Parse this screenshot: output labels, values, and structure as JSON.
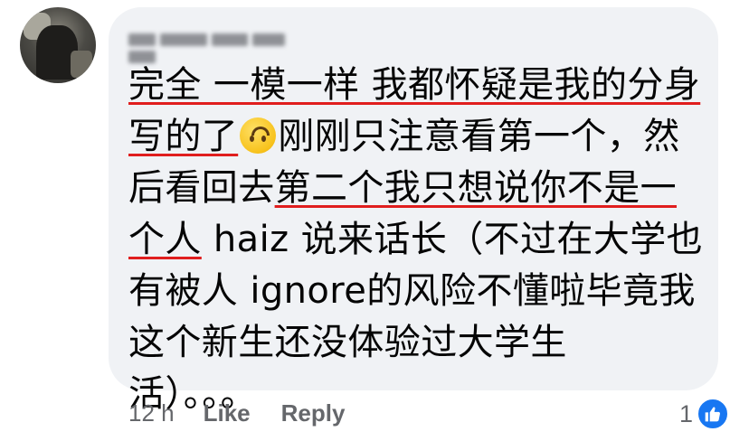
{
  "comment": {
    "author": "",
    "lines": [
      [
        {
          "t": "完全 一模一样 我都怀疑是我的分身",
          "u": true
        }
      ],
      [
        {
          "t": "写的了",
          "u": true
        },
        {
          "t": "EMOJI",
          "u": false
        },
        {
          "t": "刚刚只注意看第一个，然",
          "u": false
        }
      ],
      [
        {
          "t": "后看回去",
          "u": false
        },
        {
          "t": "第二个我只想说你不是一",
          "u": true
        }
      ],
      [
        {
          "t": "个人",
          "u": true
        },
        {
          "t": " haiz 说来话长（不过在大学也",
          "u": false
        }
      ],
      [
        {
          "t": "有被人 ignore的风险不懂啦毕竟我",
          "u": false
        }
      ],
      [
        {
          "t": "这个新生还没体验过大学生",
          "u": false
        }
      ],
      [
        {
          "t": "活）。。。",
          "u": false
        }
      ]
    ]
  },
  "meta": {
    "time": "12 h",
    "like_label": "Like",
    "reply_label": "Reply"
  },
  "reactions": {
    "count": "1",
    "icon": "thumbs-up-icon"
  },
  "colors": {
    "bubble": "#f0f2f5",
    "underline": "#e01e1e",
    "like_blue": "#1877f2",
    "meta_text": "#65676b"
  }
}
